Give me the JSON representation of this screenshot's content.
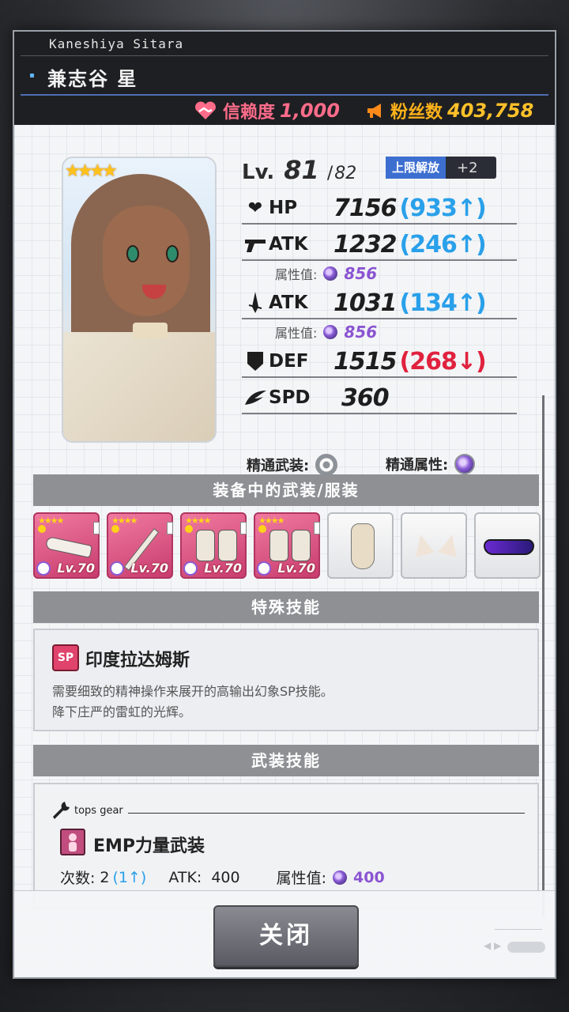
{
  "character": {
    "romaji": "Kaneshiya Sitara",
    "name": "兼志谷 星",
    "trust_label": "信赖度",
    "trust_value": "1,000",
    "fans_label": "粉丝数",
    "fans_value": "403,758",
    "rarity_stars": "★★★★"
  },
  "level": {
    "label": "Lv.",
    "current": "81",
    "separator": "/",
    "max": "82",
    "limit_break_label": "上限解放",
    "limit_break_value": "+2"
  },
  "stats": [
    {
      "icon": "heart-icon",
      "name": "HP",
      "value": "7156",
      "delta": "(933↑)",
      "trend": "up"
    },
    {
      "icon": "gun-icon",
      "name": "ATK",
      "value": "1232",
      "delta": "(246↑)",
      "trend": "up"
    },
    {
      "icon": "blade-icon",
      "name": "ATK",
      "value": "1031",
      "delta": "(134↑)",
      "trend": "up"
    },
    {
      "icon": "shield-icon",
      "name": "DEF",
      "value": "1515",
      "delta": "(268↓)",
      "trend": "down"
    },
    {
      "icon": "wing-icon",
      "name": "SPD",
      "value": "360",
      "delta": "",
      "trend": "none"
    }
  ],
  "attributes": [
    {
      "label": "属性值:",
      "value": "856"
    },
    {
      "label": "属性值:",
      "value": "856"
    }
  ],
  "mastery": {
    "weapon_label": "精通武装:",
    "attribute_label": "精通属性:"
  },
  "sections": {
    "equipment": "装备中的武装/服装",
    "special_skill": "特殊技能",
    "armament_skill": "武装技能"
  },
  "equipment": [
    {
      "type": "weapon",
      "icon": "rifle-icon",
      "level": "Lv.70"
    },
    {
      "type": "weapon",
      "icon": "spear-icon",
      "level": "Lv.70"
    },
    {
      "type": "weapon",
      "icon": "armor-icon",
      "level": "Lv.70"
    },
    {
      "type": "weapon",
      "icon": "armor-icon",
      "level": "Lv.70"
    },
    {
      "type": "costume",
      "icon": "swimsuit-icon"
    },
    {
      "type": "costume",
      "icon": "cat-ears-icon"
    },
    {
      "type": "costume",
      "icon": "sunglasses-icon"
    }
  ],
  "special_skill": {
    "badge": "SP",
    "name": "印度拉达姆斯",
    "desc_line1": "需要细致的精神操作来展开的高输出幻象SP技能。",
    "desc_line2": "降下庄严的雷虹的光辉。"
  },
  "armament_skill": {
    "gear_label": "tops gear",
    "name": "EMP力量武装",
    "count_label": "次数:",
    "count_value": "2",
    "count_up": "(1↑)",
    "atk_label": "ATK:",
    "atk_value": "400",
    "attr_label": "属性值:",
    "attr_value": "400"
  },
  "footer": {
    "close_label": "关闭"
  },
  "colors": {
    "trust": "#ff6c8a",
    "fans": "#ffc12a",
    "stat_up": "#2aa0ea",
    "stat_down": "#e0223e",
    "attribute": "#8a54d2",
    "section_bar": "#8f9094"
  }
}
